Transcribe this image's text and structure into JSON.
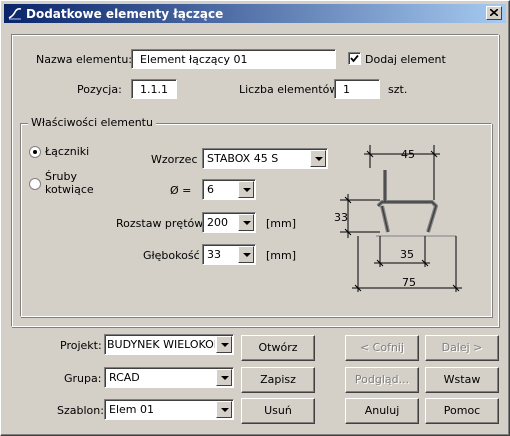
{
  "window": {
    "title": "Dodatkowe elementy łączące",
    "icon": "app-icon",
    "close_icon": "close-icon"
  },
  "element": {
    "name_label": "Nazwa elementu:",
    "name_value": "Element łączący 01",
    "add_checkbox_label": "Dodaj element",
    "add_checked": true,
    "position_label": "Pozycja:",
    "position_value": "1.1.1",
    "count_label": "Liczba elementów:",
    "count_value": "1",
    "count_unit": "szt."
  },
  "properties": {
    "group_title": "Właściwości elementu",
    "radio_connectors": "Łączniki",
    "radio_anchors_line1": "Śruby",
    "radio_anchors_line2": "kotwiące",
    "pattern_label": "Wzorzec",
    "pattern_value": "STABOX 45 S",
    "diameter_label": "Ø  =",
    "diameter_value": "6",
    "spacing_label": "Rozstaw prętów",
    "spacing_value": "200",
    "spacing_unit": "[mm]",
    "depth_label": "Głębokość",
    "depth_value": "33",
    "depth_unit": "[mm]"
  },
  "diagram": {
    "dim_top": "45",
    "dim_left": "33",
    "dim_mid": "35",
    "dim_bottom": "75"
  },
  "footer": {
    "project_label": "Projekt:",
    "project_value": "BUDYNEK WIELOKOND",
    "group_label": "Grupa:",
    "group_value": "RCAD",
    "template_label": "Szablon:",
    "template_value": "Elem 01",
    "open_button": "Otwórz",
    "save_button": "Zapisz",
    "delete_button": "Usuń",
    "back_button": "< Cofnij",
    "next_button": "Dalej >",
    "preview_button": "Podgląd...",
    "insert_button": "Wstaw",
    "cancel_button": "Anuluj",
    "help_button": "Pomoc"
  }
}
